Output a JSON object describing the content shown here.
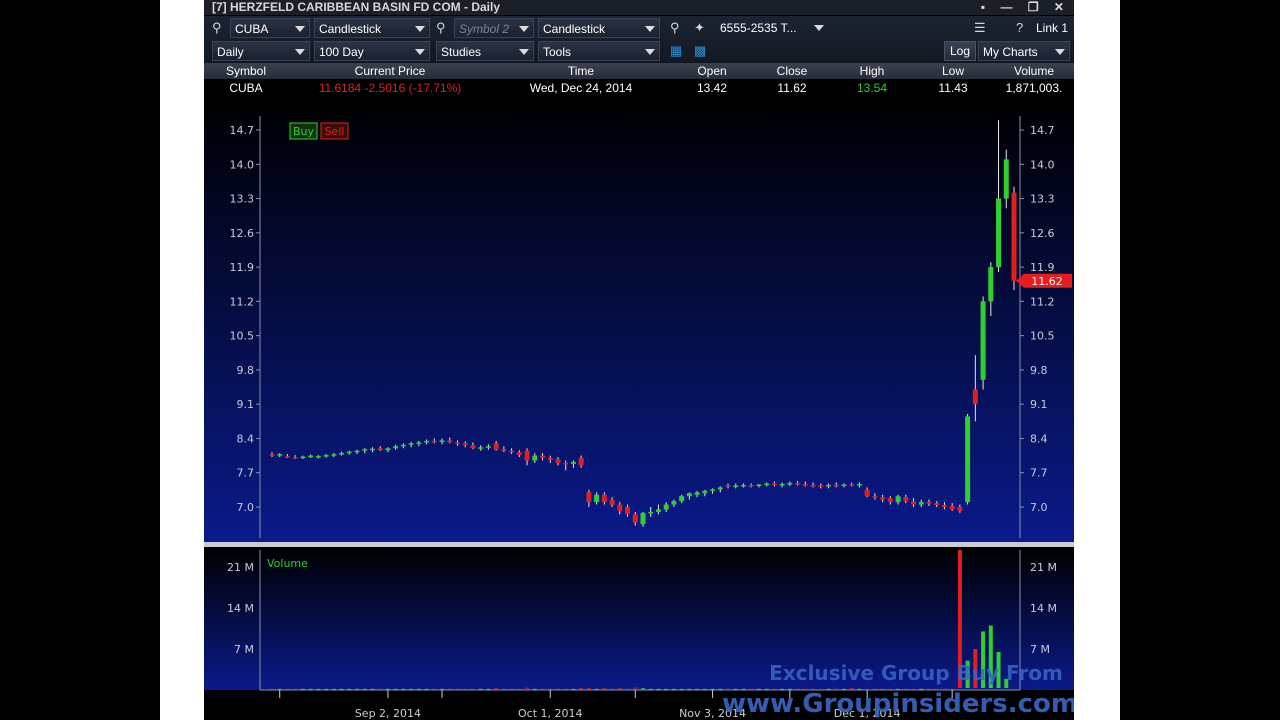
{
  "window": {
    "title": "[7] HERZFELD CARIBBEAN BASIN FD COM - Daily",
    "controls": "▪ — ❐ ✕"
  },
  "toolbar": {
    "symbol1": "CUBA",
    "chart_type1": "Candlestick",
    "symbol2_placeholder": "Symbol 2",
    "chart_type2": "Candlestick",
    "account": "6555-2535 T...",
    "link": "Link 1",
    "help": "?",
    "period": "Daily",
    "range": "100 Day",
    "studies": "Studies",
    "tools": "Tools",
    "log": "Log",
    "my_charts": "My Charts"
  },
  "quote": {
    "headers": [
      "Symbol",
      "Current Price",
      "Time",
      "Open",
      "Close",
      "High",
      "Low",
      "Volume"
    ],
    "symbol": "CUBA",
    "current_price": "11.6184  -2.5016 (-17.71%)",
    "time": "Wed, Dec 24, 2014",
    "open": "13.42",
    "close": "11.62",
    "high": "13.54",
    "low": "11.43",
    "volume": "1,871,003."
  },
  "trade": {
    "buy": "Buy",
    "sell": "Sell"
  },
  "colors": {
    "up": "#2fd02f",
    "down": "#e02020",
    "bg_top": "#000000",
    "bg_bottom": "#0a1a8a",
    "price_tag": "#e81c1c"
  },
  "watermark": {
    "line1": "Exclusive Group Buy From",
    "line2": "www.Groupinsiders.com"
  },
  "chart_data": [
    {
      "type": "candlestick",
      "title": "",
      "ylim": [
        6.6,
        15.0
      ],
      "y_ticks": [
        "14.7",
        "14.0",
        "13.3",
        "12.6",
        "11.9",
        "11.2",
        "10.5",
        "9.8",
        "9.1",
        "8.4",
        "7.7",
        "7.0"
      ],
      "x_ticks": [
        "Sep 2, 2014",
        "Oct 1, 2014",
        "Nov 3, 2014",
        "Dec 1, 2014"
      ],
      "last_price_label": "11.62",
      "candles": [
        {
          "o": 8.08,
          "h": 8.12,
          "l": 8.02,
          "c": 8.05
        },
        {
          "o": 8.05,
          "h": 8.1,
          "l": 8.02,
          "c": 8.08
        },
        {
          "o": 8.04,
          "h": 8.08,
          "l": 8.0,
          "c": 8.02
        },
        {
          "o": 8.02,
          "h": 8.06,
          "l": 7.98,
          "c": 8.01
        },
        {
          "o": 8.01,
          "h": 8.05,
          "l": 7.98,
          "c": 8.03
        },
        {
          "o": 8.03,
          "h": 8.07,
          "l": 8.0,
          "c": 8.05
        },
        {
          "o": 8.02,
          "h": 8.06,
          "l": 7.99,
          "c": 8.04
        },
        {
          "o": 8.04,
          "h": 8.08,
          "l": 8.01,
          "c": 8.06
        },
        {
          "o": 8.06,
          "h": 8.1,
          "l": 8.02,
          "c": 8.08
        },
        {
          "o": 8.08,
          "h": 8.13,
          "l": 8.05,
          "c": 8.1
        },
        {
          "o": 8.1,
          "h": 8.15,
          "l": 8.07,
          "c": 8.13
        },
        {
          "o": 8.12,
          "h": 8.17,
          "l": 8.08,
          "c": 8.15
        },
        {
          "o": 8.15,
          "h": 8.2,
          "l": 8.1,
          "c": 8.18
        },
        {
          "o": 8.17,
          "h": 8.22,
          "l": 8.12,
          "c": 8.19
        },
        {
          "o": 8.2,
          "h": 8.24,
          "l": 8.14,
          "c": 8.16
        },
        {
          "o": 8.16,
          "h": 8.22,
          "l": 8.12,
          "c": 8.2
        },
        {
          "o": 8.2,
          "h": 8.27,
          "l": 8.17,
          "c": 8.24
        },
        {
          "o": 8.24,
          "h": 8.3,
          "l": 8.2,
          "c": 8.27
        },
        {
          "o": 8.27,
          "h": 8.33,
          "l": 8.22,
          "c": 8.3
        },
        {
          "o": 8.29,
          "h": 8.35,
          "l": 8.24,
          "c": 8.32
        },
        {
          "o": 8.32,
          "h": 8.38,
          "l": 8.28,
          "c": 8.35
        },
        {
          "o": 8.35,
          "h": 8.4,
          "l": 8.3,
          "c": 8.34
        },
        {
          "o": 8.33,
          "h": 8.4,
          "l": 8.28,
          "c": 8.36
        },
        {
          "o": 8.36,
          "h": 8.42,
          "l": 8.3,
          "c": 8.32
        },
        {
          "o": 8.32,
          "h": 8.36,
          "l": 8.25,
          "c": 8.3
        },
        {
          "o": 8.3,
          "h": 8.34,
          "l": 8.22,
          "c": 8.26
        },
        {
          "o": 8.26,
          "h": 8.32,
          "l": 8.18,
          "c": 8.2
        },
        {
          "o": 8.2,
          "h": 8.26,
          "l": 8.15,
          "c": 8.22
        },
        {
          "o": 8.22,
          "h": 8.28,
          "l": 8.17,
          "c": 8.24
        },
        {
          "o": 8.3,
          "h": 8.35,
          "l": 8.15,
          "c": 8.17
        },
        {
          "o": 8.18,
          "h": 8.24,
          "l": 8.12,
          "c": 8.15
        },
        {
          "o": 8.15,
          "h": 8.2,
          "l": 8.08,
          "c": 8.12
        },
        {
          "o": 8.12,
          "h": 8.16,
          "l": 8.02,
          "c": 8.06
        },
        {
          "o": 8.15,
          "h": 8.2,
          "l": 7.85,
          "c": 7.95
        },
        {
          "o": 7.95,
          "h": 8.1,
          "l": 7.9,
          "c": 8.05
        },
        {
          "o": 8.05,
          "h": 8.1,
          "l": 7.95,
          "c": 8.0
        },
        {
          "o": 8.0,
          "h": 8.05,
          "l": 7.9,
          "c": 7.98
        },
        {
          "o": 7.98,
          "h": 8.02,
          "l": 7.85,
          "c": 7.9
        },
        {
          "o": 7.9,
          "h": 7.95,
          "l": 7.75,
          "c": 7.88
        },
        {
          "o": 7.88,
          "h": 7.95,
          "l": 7.8,
          "c": 7.92
        },
        {
          "o": 8.0,
          "h": 8.05,
          "l": 7.8,
          "c": 7.85
        },
        {
          "o": 7.3,
          "h": 7.35,
          "l": 7.0,
          "c": 7.1
        },
        {
          "o": 7.1,
          "h": 7.3,
          "l": 7.05,
          "c": 7.25
        },
        {
          "o": 7.25,
          "h": 7.3,
          "l": 7.05,
          "c": 7.1
        },
        {
          "o": 7.15,
          "h": 7.2,
          "l": 7.0,
          "c": 7.05
        },
        {
          "o": 7.05,
          "h": 7.1,
          "l": 6.85,
          "c": 6.92
        },
        {
          "o": 7.0,
          "h": 7.05,
          "l": 6.8,
          "c": 6.85
        },
        {
          "o": 6.85,
          "h": 6.9,
          "l": 6.62,
          "c": 6.68
        },
        {
          "o": 6.65,
          "h": 6.9,
          "l": 6.6,
          "c": 6.88
        },
        {
          "o": 6.88,
          "h": 7.0,
          "l": 6.8,
          "c": 6.9
        },
        {
          "o": 6.9,
          "h": 7.05,
          "l": 6.85,
          "c": 6.95
        },
        {
          "o": 6.95,
          "h": 7.1,
          "l": 6.9,
          "c": 7.05
        },
        {
          "o": 7.05,
          "h": 7.15,
          "l": 7.0,
          "c": 7.12
        },
        {
          "o": 7.12,
          "h": 7.25,
          "l": 7.08,
          "c": 7.22
        },
        {
          "o": 7.22,
          "h": 7.3,
          "l": 7.15,
          "c": 7.28
        },
        {
          "o": 7.25,
          "h": 7.33,
          "l": 7.2,
          "c": 7.3
        },
        {
          "o": 7.28,
          "h": 7.35,
          "l": 7.22,
          "c": 7.33
        },
        {
          "o": 7.33,
          "h": 7.38,
          "l": 7.27,
          "c": 7.36
        },
        {
          "o": 7.36,
          "h": 7.42,
          "l": 7.3,
          "c": 7.4
        },
        {
          "o": 7.45,
          "h": 7.48,
          "l": 7.38,
          "c": 7.42
        },
        {
          "o": 7.44,
          "h": 7.48,
          "l": 7.38,
          "c": 7.44
        },
        {
          "o": 7.44,
          "h": 7.48,
          "l": 7.4,
          "c": 7.45
        },
        {
          "o": 7.45,
          "h": 7.48,
          "l": 7.4,
          "c": 7.43
        },
        {
          "o": 7.43,
          "h": 7.47,
          "l": 7.4,
          "c": 7.46
        },
        {
          "o": 7.46,
          "h": 7.5,
          "l": 7.42,
          "c": 7.48
        },
        {
          "o": 7.48,
          "h": 7.52,
          "l": 7.42,
          "c": 7.45
        },
        {
          "o": 7.45,
          "h": 7.5,
          "l": 7.4,
          "c": 7.47
        },
        {
          "o": 7.47,
          "h": 7.52,
          "l": 7.43,
          "c": 7.49
        },
        {
          "o": 7.49,
          "h": 7.53,
          "l": 7.44,
          "c": 7.47
        },
        {
          "o": 7.47,
          "h": 7.52,
          "l": 7.42,
          "c": 7.45
        },
        {
          "o": 7.45,
          "h": 7.5,
          "l": 7.4,
          "c": 7.44
        },
        {
          "o": 7.44,
          "h": 7.48,
          "l": 7.38,
          "c": 7.42
        },
        {
          "o": 7.42,
          "h": 7.48,
          "l": 7.38,
          "c": 7.45
        },
        {
          "o": 7.45,
          "h": 7.5,
          "l": 7.4,
          "c": 7.44
        },
        {
          "o": 7.44,
          "h": 7.48,
          "l": 7.4,
          "c": 7.46
        },
        {
          "o": 7.46,
          "h": 7.5,
          "l": 7.42,
          "c": 7.45
        },
        {
          "o": 7.45,
          "h": 7.5,
          "l": 7.4,
          "c": 7.47
        },
        {
          "o": 7.35,
          "h": 7.4,
          "l": 7.2,
          "c": 7.22
        },
        {
          "o": 7.22,
          "h": 7.28,
          "l": 7.15,
          "c": 7.2
        },
        {
          "o": 7.2,
          "h": 7.25,
          "l": 7.1,
          "c": 7.15
        },
        {
          "o": 7.18,
          "h": 7.22,
          "l": 7.05,
          "c": 7.1
        },
        {
          "o": 7.1,
          "h": 7.25,
          "l": 7.05,
          "c": 7.22
        },
        {
          "o": 7.2,
          "h": 7.25,
          "l": 7.08,
          "c": 7.12
        },
        {
          "o": 7.12,
          "h": 7.18,
          "l": 7.0,
          "c": 7.05
        },
        {
          "o": 7.05,
          "h": 7.15,
          "l": 7.0,
          "c": 7.1
        },
        {
          "o": 7.1,
          "h": 7.15,
          "l": 7.02,
          "c": 7.08
        },
        {
          "o": 7.08,
          "h": 7.12,
          "l": 7.0,
          "c": 7.04
        },
        {
          "o": 7.04,
          "h": 7.1,
          "l": 6.95,
          "c": 7.0
        },
        {
          "o": 7.02,
          "h": 7.08,
          "l": 6.92,
          "c": 6.95
        },
        {
          "o": 7.0,
          "h": 7.05,
          "l": 6.88,
          "c": 6.92
        },
        {
          "o": 7.1,
          "h": 8.9,
          "l": 7.05,
          "c": 8.85
        },
        {
          "o": 9.4,
          "h": 10.1,
          "l": 8.75,
          "c": 9.1
        },
        {
          "o": 9.6,
          "h": 11.3,
          "l": 9.4,
          "c": 11.2
        },
        {
          "o": 11.2,
          "h": 12.0,
          "l": 10.9,
          "c": 11.9
        },
        {
          "o": 11.9,
          "h": 14.9,
          "l": 11.8,
          "c": 13.3
        },
        {
          "o": 13.3,
          "h": 14.3,
          "l": 13.1,
          "c": 14.1
        },
        {
          "o": 13.42,
          "h": 13.54,
          "l": 11.43,
          "c": 11.62
        }
      ]
    },
    {
      "type": "bar",
      "title": "Volume",
      "ylim": [
        0,
        24
      ],
      "y_ticks": [
        "21 M",
        "14 M",
        "7 M"
      ],
      "values_millions": [
        0.2,
        0.2,
        0.2,
        0.2,
        0.2,
        0.2,
        0.2,
        0.2,
        0.2,
        0.2,
        0.2,
        0.2,
        0.2,
        0.2,
        0.2,
        0.2,
        0.2,
        0.2,
        0.2,
        0.2,
        0.2,
        0.2,
        0.2,
        0.2,
        0.2,
        0.2,
        0.2,
        0.2,
        0.2,
        0.3,
        0.2,
        0.2,
        0.2,
        0.4,
        0.2,
        0.2,
        0.2,
        0.2,
        0.2,
        0.2,
        0.3,
        0.3,
        0.2,
        0.3,
        0.2,
        0.3,
        0.2,
        0.4,
        0.3,
        0.2,
        0.2,
        0.2,
        0.2,
        0.2,
        0.2,
        0.2,
        0.2,
        0.2,
        0.2,
        0.2,
        0.2,
        0.2,
        0.2,
        0.2,
        0.2,
        0.2,
        0.2,
        0.2,
        0.2,
        0.2,
        0.2,
        0.2,
        0.2,
        0.2,
        0.2,
        0.3,
        0.2,
        0.2,
        0.2,
        0.2,
        0.2,
        0.2,
        0.2,
        0.2,
        0.2,
        0.2,
        0.2,
        0.2,
        0.2,
        24.0,
        5.0,
        7.0,
        10.0,
        11.0,
        6.5,
        1.9
      ]
    }
  ]
}
